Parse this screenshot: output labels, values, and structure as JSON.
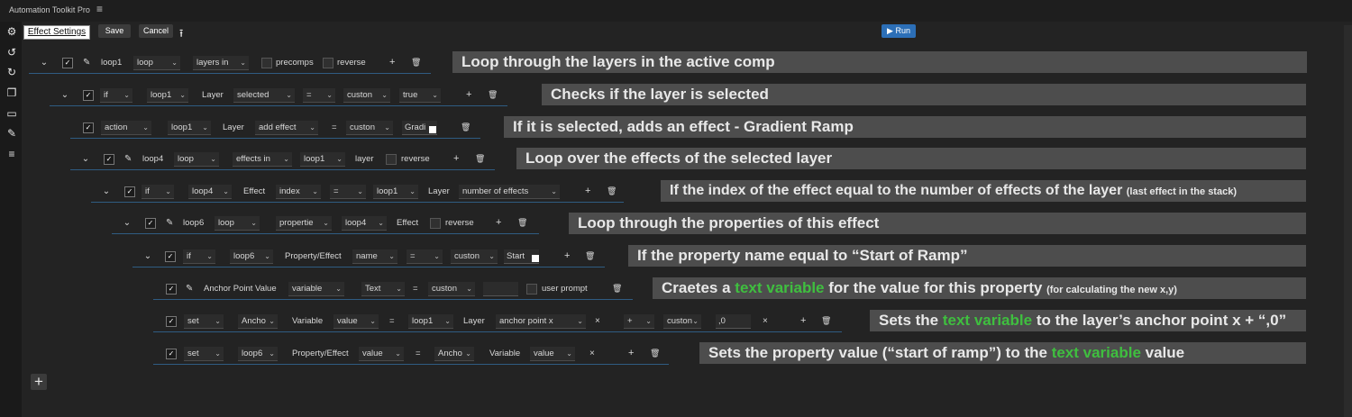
{
  "app": {
    "title": "Automation Toolkit Pro",
    "menu_icon": "hamburger-icon"
  },
  "toolbar": {
    "tab_label": "Effect Settings",
    "save": "Save",
    "cancel": "Cancel",
    "run": "▶ Run"
  },
  "rows": [
    {
      "items": [
        "loop1",
        "loop",
        "layers in",
        "precomps",
        "reverse"
      ]
    },
    {
      "items": [
        "if",
        "loop1",
        "Layer",
        "selected",
        "=",
        "custon",
        "true"
      ]
    },
    {
      "items": [
        "action",
        "loop1",
        "Layer",
        "add effect",
        "=",
        "custon",
        "Gradi"
      ]
    },
    {
      "items": [
        "loop4",
        "loop",
        "effects in",
        "loop1",
        "layer",
        "reverse"
      ]
    },
    {
      "items": [
        "if",
        "loop4",
        "Effect",
        "index",
        "=",
        "loop1",
        "Layer",
        "number of effects"
      ]
    },
    {
      "items": [
        "loop6",
        "loop",
        "propertie",
        "loop4",
        "Effect",
        "reverse"
      ]
    },
    {
      "items": [
        "if",
        "loop6",
        "Property/Effect",
        "name",
        "=",
        "custon",
        "Start"
      ]
    },
    {
      "items": [
        "Anchor Point Value",
        "variable",
        "Text",
        "=",
        "custon",
        "user prompt"
      ]
    },
    {
      "items": [
        "set",
        "Ancho",
        "Variable",
        "value",
        "=",
        "loop1",
        "Layer",
        "anchor point x",
        "×",
        "+",
        "custon",
        ",0",
        "×"
      ]
    },
    {
      "items": [
        "set",
        "loop6",
        "Property/Effect",
        "value",
        "=",
        "Ancho",
        "Variable",
        "value",
        "×"
      ]
    }
  ],
  "annotations": {
    "a1": "Loop through the layers in the active comp",
    "a2": "Checks if the layer is selected",
    "a3": "If it is selected, adds an effect - Gradient Ramp",
    "a4": "Loop over the effects of the selected layer",
    "a5_main": "If the index of the effect equal to the number of effects of the layer ",
    "a5_small": "(last effect in the stack)",
    "a6": "Loop through the properties of this effect",
    "a7": "If the property name equal to “Start of Ramp”",
    "a8_pre": "Craetes a ",
    "a8_green": "text variable",
    "a8_mid": " for the value for this property ",
    "a8_small": "(for calculating the new x,y)",
    "a9_pre": "Sets the ",
    "a9_green": "text variable",
    "a9_post": " to the layer’s anchor point x + “,0”",
    "a10_pre": "Sets the property value (“start of ramp”) to the ",
    "a10_green": "text variable",
    "a10_post": " value"
  },
  "colors": {
    "accent_green": "#3fbf3f",
    "run_blue": "#2c6fb7",
    "row_underline": "#2f5c82"
  }
}
